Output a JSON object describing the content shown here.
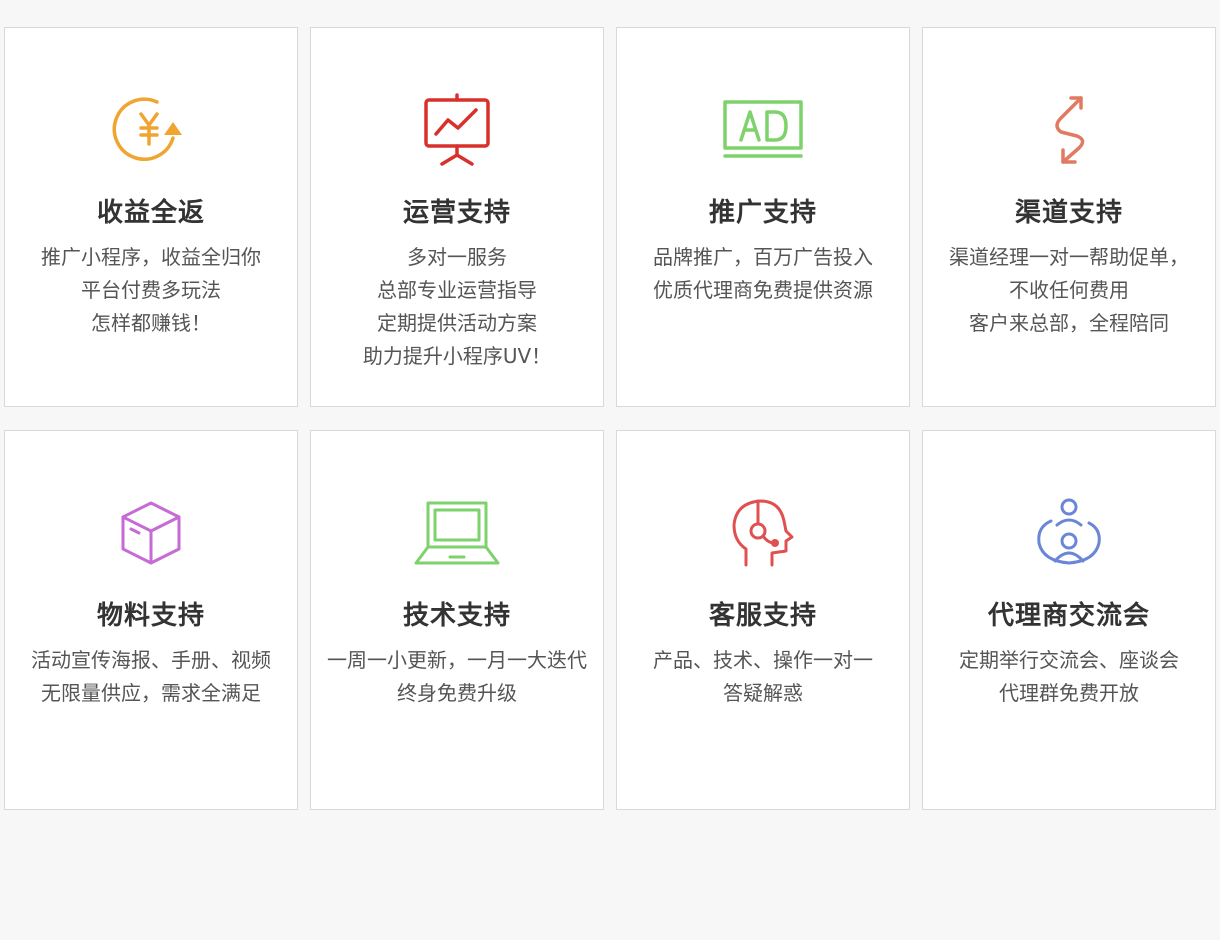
{
  "cards": [
    {
      "icon": "yen-refresh-icon",
      "color": "#f0a431",
      "title": "收益全返",
      "lines": [
        "推广小程序，收益全归你",
        "平台付费多玩法",
        "怎样都赚钱！"
      ]
    },
    {
      "icon": "presentation-chart-icon",
      "color": "#d9302c",
      "title": "运营支持",
      "lines": [
        "多对一服务",
        "总部专业运营指导",
        "定期提供活动方案",
        "助力提升小程序UV！"
      ]
    },
    {
      "icon": "ad-screen-icon",
      "color": "#7ed26b",
      "title": "推广支持",
      "lines": [
        "品牌推广，百万广告投入",
        "优质代理商免费提供资源"
      ]
    },
    {
      "icon": "route-arrows-icon",
      "color": "#e07a62",
      "title": "渠道支持",
      "lines": [
        "渠道经理一对一帮助促单，",
        "不收任何费用",
        "客户来总部，全程陪同"
      ]
    },
    {
      "icon": "box-icon",
      "color": "#c66ad6",
      "title": "物料支持",
      "lines": [
        "活动宣传海报、手册、视频",
        "无限量供应，需求全满足"
      ]
    },
    {
      "icon": "laptop-icon",
      "color": "#7ed26b",
      "title": "技术支持",
      "lines": [
        "一周一小更新，一月一大迭代",
        "终身免费升级"
      ]
    },
    {
      "icon": "headset-head-icon",
      "color": "#e05050",
      "title": "客服支持",
      "lines": [
        "产品、技术、操作一对一",
        "答疑解惑"
      ]
    },
    {
      "icon": "people-group-icon",
      "color": "#6b86d6",
      "title": "代理商交流会",
      "lines": [
        "定期举行交流会、座谈会",
        "代理群免费开放"
      ]
    }
  ]
}
